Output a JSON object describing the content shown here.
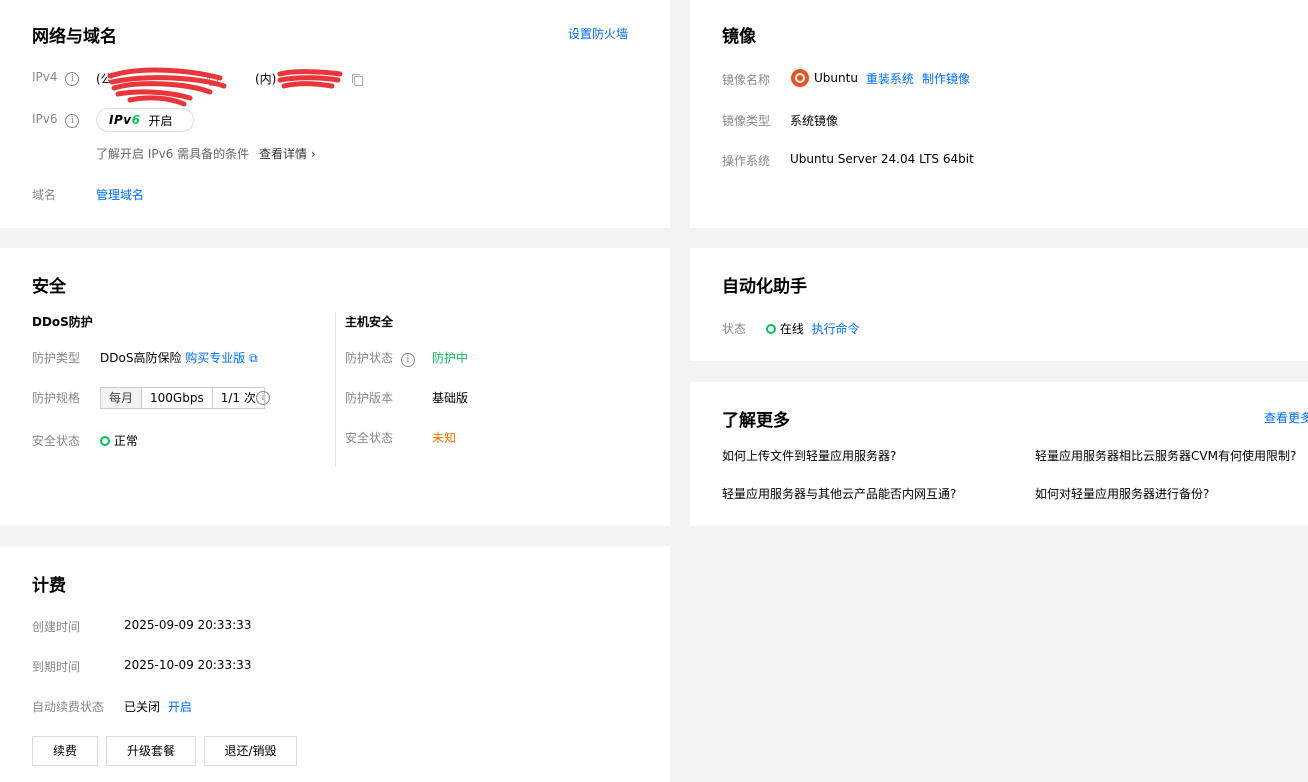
{
  "network": {
    "title": "网络与域名",
    "firewall_link": "设置防火墙",
    "ipv4_label": "IPv4",
    "ipv4_public_prefix": "(公",
    "ipv4_private_prefix": "(内)",
    "ipv6_label": "IPv6",
    "ipv6_logo_a": "IPv",
    "ipv6_logo_b": "6",
    "ipv6_status": "开启",
    "ipv6_hint": "了解开启 IPv6 需具备的条件",
    "ipv6_details": "查看详情",
    "domain_label": "域名",
    "domain_link": "管理域名"
  },
  "image": {
    "title": "镜像",
    "name_label": "镜像名称",
    "name_value": "Ubuntu",
    "reinstall_link": "重装系统",
    "make_image_link": "制作镜像",
    "type_label": "镜像类型",
    "type_value": "系统镜像",
    "os_label": "操作系统",
    "os_value": "Ubuntu Server 24.04 LTS 64bit"
  },
  "security": {
    "title": "安全",
    "ddos_title": "DDoS防护",
    "ddos_type_label": "防护类型",
    "ddos_type_value": "DDoS高防保险",
    "ddos_buy_link": "购买专业版",
    "ddos_spec_label": "防护规格",
    "ddos_spec_period": "每月",
    "ddos_spec_bandwidth": "100Gbps",
    "ddos_spec_times": "1/1 次",
    "ddos_status_label": "安全状态",
    "ddos_status_value": "正常",
    "host_title": "主机安全",
    "host_status_label": "防护状态",
    "host_status_value": "防护中",
    "host_version_label": "防护版本",
    "host_version_value": "基础版",
    "host_safety_label": "安全状态",
    "host_safety_value": "未知"
  },
  "automation": {
    "title": "自动化助手",
    "status_label": "状态",
    "status_value": "在线",
    "exec_link": "执行命令"
  },
  "learn_more": {
    "title": "了解更多",
    "more_link": "查看更多",
    "links": [
      "如何上传文件到轻量应用服务器?",
      "轻量应用服务器相比云服务器CVM有何使用限制?",
      "轻量应用服务器与其他云产品能否内网互通?",
      "如何对轻量应用服务器进行备份?"
    ]
  },
  "billing": {
    "title": "计费",
    "created_label": "创建时间",
    "created_value": "2025-09-09 20:33:33",
    "expire_label": "到期时间",
    "expire_value": "2025-10-09 20:33:33",
    "autorenew_label": "自动续费状态",
    "autorenew_value": "已关闭",
    "autorenew_link": "开启",
    "renew_button": "续费",
    "upgrade_button": "升级套餐",
    "refund_button": "退还/销毁"
  },
  "colors": {
    "link": "#006eff",
    "success": "#0abf5b",
    "warning": "#ff7200",
    "ubuntu": "#e95420",
    "redaction": "#e8363a"
  }
}
